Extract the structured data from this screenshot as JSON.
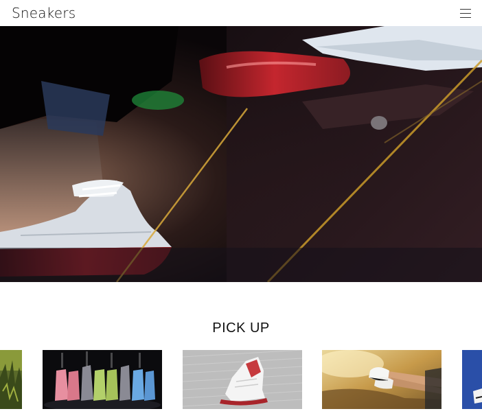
{
  "header": {
    "logo_text": "Sneakers",
    "menu_icon": "hamburger-menu-icon"
  },
  "hero": {
    "image": "sneaker-pedal-closeup-photo"
  },
  "pickup": {
    "title": "PICK UP",
    "items": [
      {
        "image": "grass-sneakers-photo"
      },
      {
        "image": "colorful-sneakers-row-photo"
      },
      {
        "image": "white-red-high-top-sneaker-photo"
      },
      {
        "image": "white-sneakers-crossed-legs-photo"
      },
      {
        "image": "blue-sneaker-photo"
      }
    ]
  },
  "colors": {
    "text": "#111111",
    "background": "#ffffff",
    "accent_red": "#d2282e",
    "accent_blue": "#2a4fa8"
  }
}
